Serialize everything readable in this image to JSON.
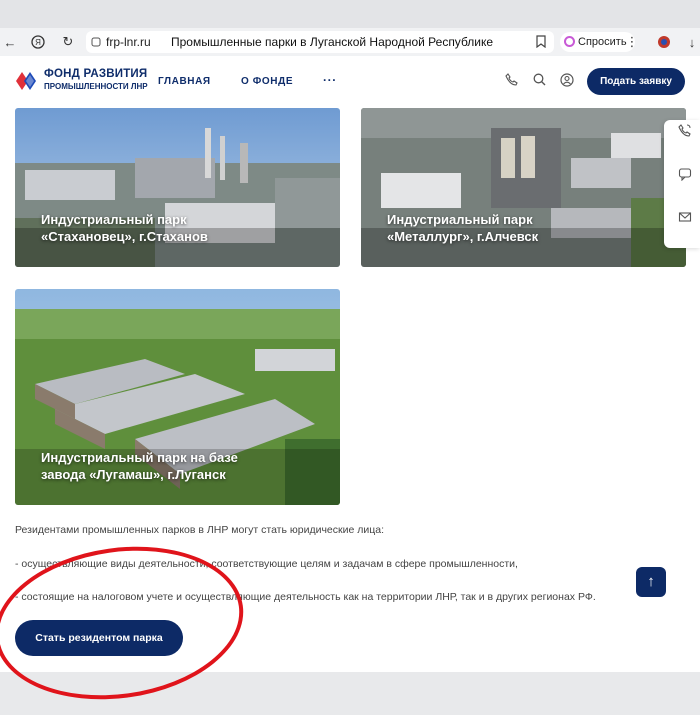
{
  "browser": {
    "domain": "frp-lnr.ru",
    "page_title": "Промышленные парки в Луганской Народной Республике",
    "ask_label": "Спросить"
  },
  "header": {
    "logo_line1": "ФОНД РАЗВИТИЯ",
    "logo_line2": "ПРОМЫШЛЕННОСТИ ЛНР",
    "nav": [
      "ГЛАВНАЯ",
      "О ФОНДЕ",
      "···"
    ],
    "apply_label": "Подать заявку"
  },
  "parks": [
    {
      "title_line1": "Индустриальный парк",
      "title_line2": "«Стахановец», г.Стаханов"
    },
    {
      "title_line1": "Индустриальный парк",
      "title_line2": "«Металлург», г.Алчевск"
    },
    {
      "title_line1": "Индустриальный парк на базе",
      "title_line2": "завода «Лугамаш», г.Луганск"
    }
  ],
  "info": {
    "intro": "Резидентами промышленных парков в ЛНР могут стать юридические лица:",
    "bullet1": "- осуществляющие виды деятельности, соответствующие целям и задачам в сфере промышленности,",
    "bullet2": "- состоящие на налоговом учете и осуществляющие деятельность как на территории ЛНР, так и в других регионах РФ."
  },
  "cta": {
    "resident_label": "Стать резидентом парка"
  },
  "colors": {
    "brand": "#0d2a66",
    "annotation": "#e0141b"
  }
}
